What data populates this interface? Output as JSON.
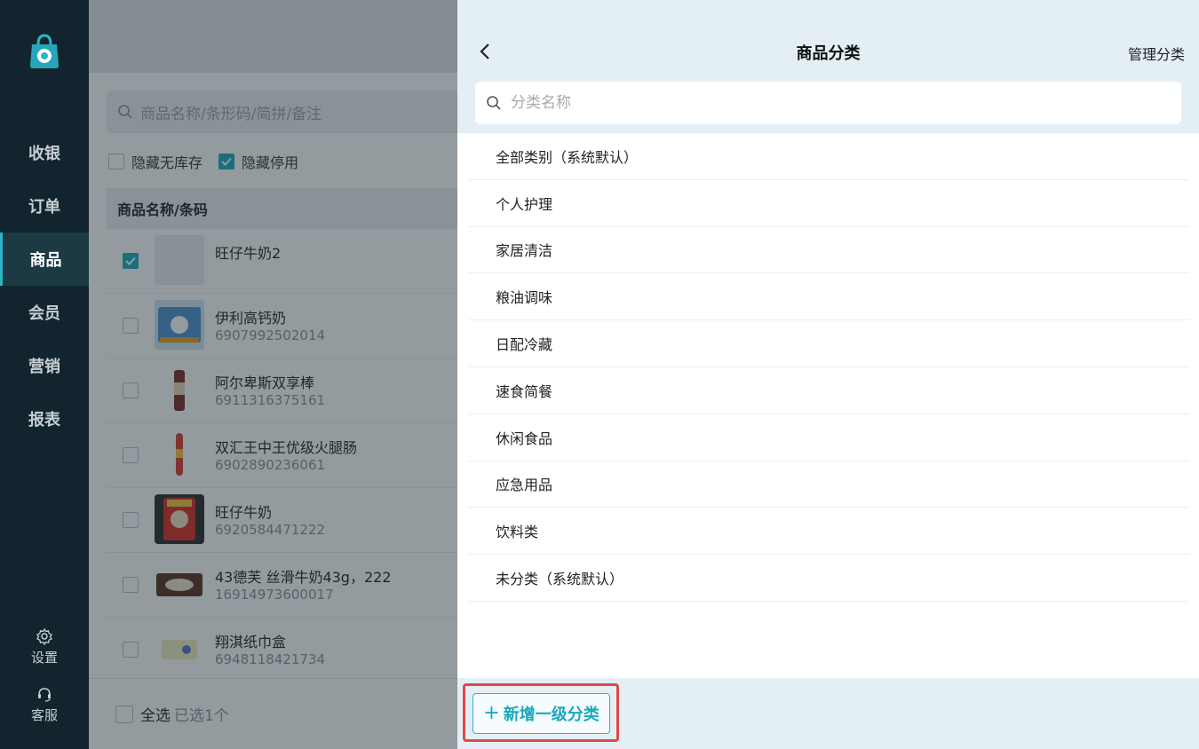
{
  "sidebar": {
    "items": [
      {
        "label": "收银"
      },
      {
        "label": "订单"
      },
      {
        "label": "商品"
      },
      {
        "label": "会员"
      },
      {
        "label": "营销"
      },
      {
        "label": "报表"
      }
    ],
    "active_item": "商品",
    "settings_label": "设置",
    "support_label": "客服"
  },
  "product_list": {
    "search_placeholder": "商品名称/条形码/简拼/备注",
    "filters": {
      "hide_out_of_stock": {
        "label": "隐藏无库存",
        "checked": false
      },
      "hide_disabled": {
        "label": "隐藏停用",
        "checked": true
      }
    },
    "column_header": "商品名称/条码",
    "rows": [
      {
        "name": "旺仔牛奶2",
        "code": "",
        "checked": true
      },
      {
        "name": "伊利高钙奶",
        "code": "6907992502014",
        "checked": false
      },
      {
        "name": "阿尔卑斯双享棒",
        "code": "6911316375161",
        "checked": false
      },
      {
        "name": "双汇王中王优级火腿肠",
        "code": "6902890236061",
        "checked": false
      },
      {
        "name": "旺仔牛奶",
        "code": "6920584471222",
        "checked": false
      },
      {
        "name": "43德芙 丝滑牛奶43g，222",
        "code": "16914973600017",
        "checked": false
      },
      {
        "name": "翔淇纸巾盒",
        "code": "6948118421734",
        "checked": false
      }
    ],
    "select_all_label": "全选",
    "selected_count_label": "已选1个"
  },
  "category_panel": {
    "title": "商品分类",
    "manage_label": "管理分类",
    "search_placeholder": "分类名称",
    "categories": [
      {
        "label": "全部类别（系统默认）"
      },
      {
        "label": "个人护理"
      },
      {
        "label": "家居清洁"
      },
      {
        "label": "粮油调味"
      },
      {
        "label": "日配冷藏"
      },
      {
        "label": "速食简餐"
      },
      {
        "label": "休闲食品"
      },
      {
        "label": "应急用品"
      },
      {
        "label": "饮料类"
      },
      {
        "label": "未分类（系统默认）"
      }
    ],
    "add_button_label": "新增一级分类"
  },
  "colors": {
    "sidebar_bg": "#12252e",
    "accent": "#19a9be",
    "highlight": "#e04848",
    "panel_header_bg": "#e4eff5"
  }
}
